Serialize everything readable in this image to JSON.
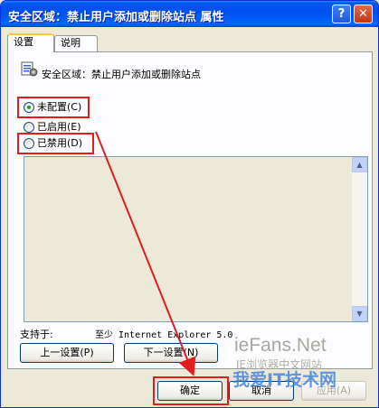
{
  "window": {
    "title": "安全区域：禁止用户添加或删除站点 属性",
    "help_label": "?",
    "close_label": "✕"
  },
  "tabs": [
    {
      "label": "设置",
      "active": true
    },
    {
      "label": "说明",
      "active": false
    }
  ],
  "policy": {
    "icon": "policy-setting-icon",
    "title": "安全区域：禁止用户添加或删除站点"
  },
  "options": [
    {
      "label": "未配置(C)",
      "selected": true
    },
    {
      "label": "已启用(E)",
      "selected": false
    },
    {
      "label": "已禁用(D)",
      "selected": false
    }
  ],
  "supported": {
    "label": "支持于:",
    "value": "至少 Internet Explorer 5.0"
  },
  "nav": {
    "prev_label": "上一设置(P)",
    "next_label": "下一设置(N)"
  },
  "footer": {
    "ok_label": "确定",
    "cancel_label": "取消",
    "apply_label": "应用(A)"
  },
  "watermark": {
    "line1": "ieFans.Net",
    "line2": "IE浏览器中文网站",
    "line3": "我爱IT技术网"
  },
  "colors": {
    "highlight": "#e01e1e",
    "title_bar": "#0053ee"
  }
}
